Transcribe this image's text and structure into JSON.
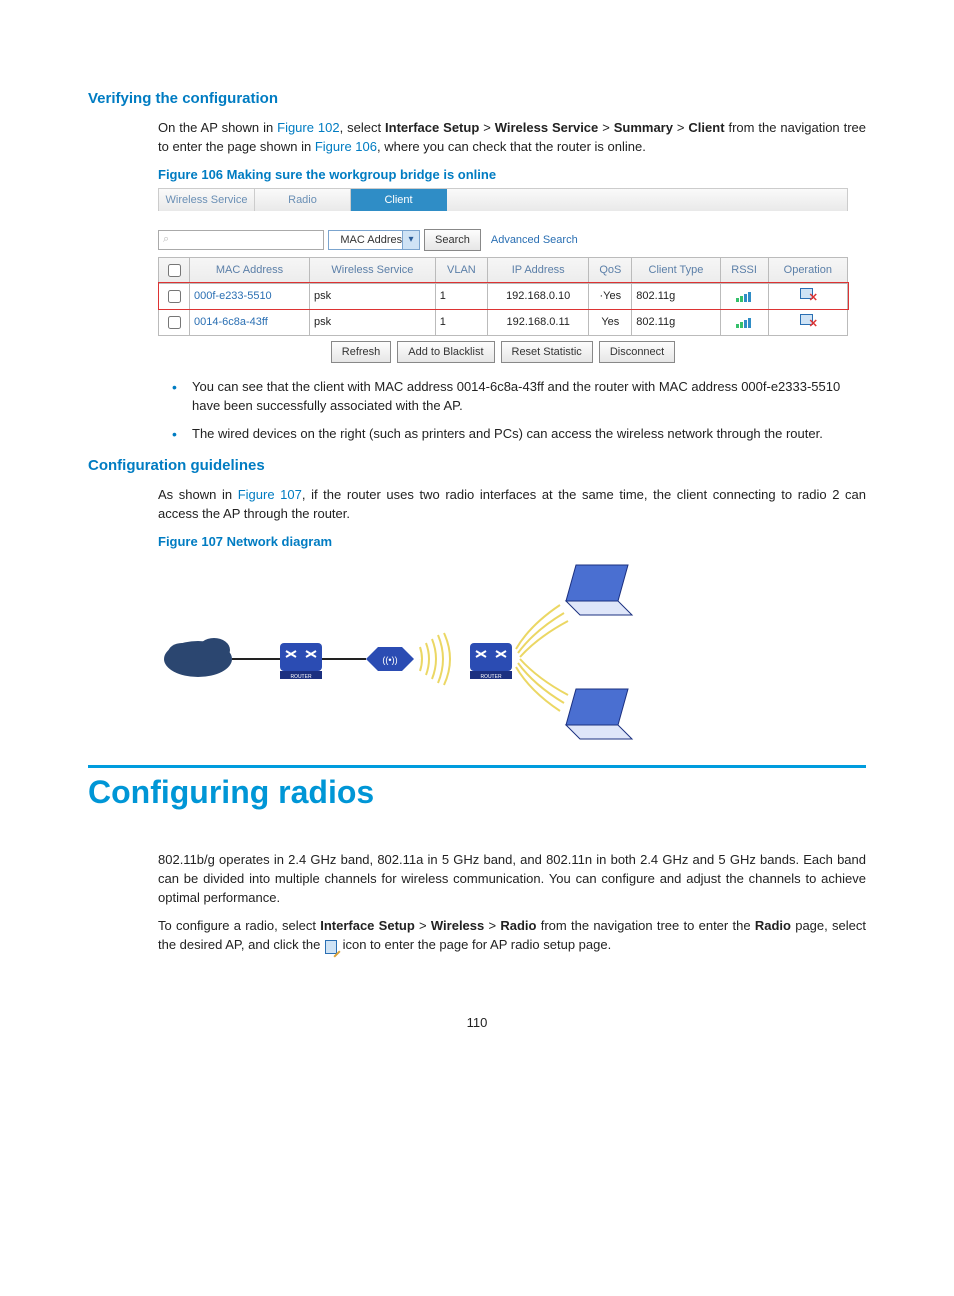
{
  "sec1": {
    "h": "Verifying the configuration",
    "p1a": "On the AP shown in ",
    "p1link1": "Figure 102",
    "p1b": ", select ",
    "p1bold1": "Interface Setup",
    "gt": " > ",
    "p1bold2": "Wireless Service",
    "p1bold3": "Summary",
    "p1bold4": "Client",
    "p1c": " from the navigation tree to enter the page shown in ",
    "p1link2": "Figure 106",
    "p1d": ", where you can check that the router is online.",
    "figcap": "Figure 106 Making sure the workgroup bridge is online"
  },
  "shot": {
    "tabs": [
      "Wireless Service",
      "Radio",
      "Client"
    ],
    "activeTab": 2,
    "searchIcon": "⌕",
    "select": "MAC Address",
    "searchBtn": "Search",
    "adv": "Advanced Search",
    "headers": [
      "",
      "MAC Address",
      "Wireless Service",
      "VLAN",
      "IP Address",
      "QoS",
      "Client Type",
      "RSSI",
      "Operation"
    ],
    "rows": [
      {
        "mac": "000f-e233-5510",
        "ws": "psk",
        "vlan": "1",
        "ip": "192.168.0.10",
        "qos": "·Yes",
        "ct": "802.11g"
      },
      {
        "mac": "0014-6c8a-43ff",
        "ws": "psk",
        "vlan": "1",
        "ip": "192.168.0.11",
        "qos": "Yes",
        "ct": "802.11g"
      }
    ],
    "actions": [
      "Refresh",
      "Add to Blacklist",
      "Reset Statistic",
      "Disconnect"
    ]
  },
  "bul": [
    "You can see that the client with MAC address 0014-6c8a-43ff and the router with MAC address 000f-e2333-5510 have been successfully associated with the AP.",
    "The wired devices on the right (such as printers and PCs) can access the wireless network through the router."
  ],
  "sec2": {
    "h": "Configuration guidelines",
    "p1a": "As shown in ",
    "p1link": "Figure 107",
    "p1b": ", if the router uses two radio interfaces at the same time, the client connecting to radio 2 can access the AP through the router.",
    "figcap": "Figure 107 Network diagram"
  },
  "sec3": {
    "h": "Configuring radios",
    "p1": "802.11b/g operates in 2.4 GHz band, 802.11a in 5 GHz band, and 802.11n in both 2.4 GHz and 5 GHz bands. Each band can be divided into multiple channels for wireless communication. You can configure and adjust the channels to achieve optimal performance.",
    "p2a": "To configure a radio, select ",
    "p2b1": "Interface Setup",
    "p2b2": "Wireless",
    "p2b3": "Radio",
    "p2b": " from the navigation tree to enter the ",
    "p2b4": "Radio",
    "p2c": " page, select the desired AP, and click the ",
    "p2d": " icon to enter the page for AP radio setup page."
  },
  "pagenum": "110"
}
